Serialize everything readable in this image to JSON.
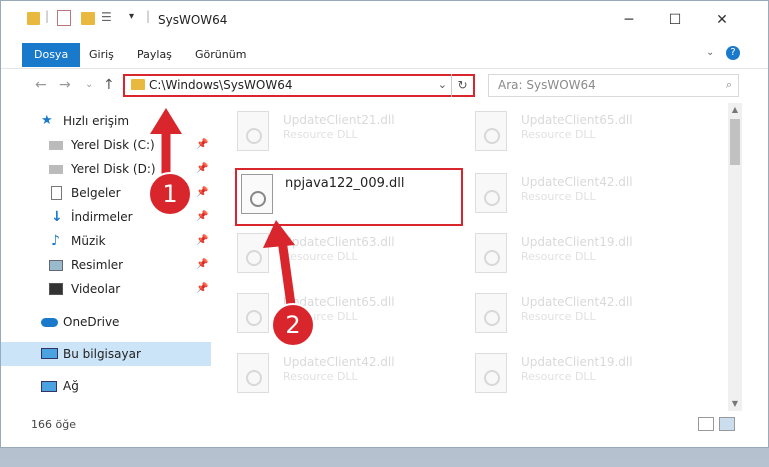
{
  "window": {
    "title": "SysWOW64",
    "controls": {
      "minimize": "─",
      "maximize": "☐",
      "close": "✕"
    }
  },
  "ribbon": {
    "tabs": [
      {
        "label": "Dosya",
        "active": true
      },
      {
        "label": "Giriş"
      },
      {
        "label": "Paylaş"
      },
      {
        "label": "Görünüm"
      }
    ],
    "expand_icon": "chevron-down-icon",
    "help_icon": "?"
  },
  "address": {
    "path": "C:\\Windows\\SysWOW64",
    "search_placeholder": "Ara: SysWOW64"
  },
  "nav": {
    "items": [
      {
        "label": "Hızlı erişim",
        "icon": "star-icon"
      },
      {
        "label": "Yerel Disk (C:)",
        "icon": "drive-icon",
        "pinned": true
      },
      {
        "label": "Yerel Disk (D:)",
        "icon": "drive-icon",
        "pinned": true
      },
      {
        "label": "Belgeler",
        "icon": "documents-icon",
        "pinned": true
      },
      {
        "label": "İndirmeler",
        "icon": "download-icon",
        "pinned": true
      },
      {
        "label": "Müzik",
        "icon": "music-icon",
        "pinned": true
      },
      {
        "label": "Resimler",
        "icon": "pictures-icon",
        "pinned": true
      },
      {
        "label": "Videolar",
        "icon": "videos-icon",
        "pinned": true
      },
      {
        "label": "OneDrive",
        "icon": "cloud-icon"
      },
      {
        "label": "Bu bilgisayar",
        "icon": "computer-icon",
        "selected": true
      },
      {
        "label": "Ağ",
        "icon": "network-icon"
      }
    ]
  },
  "files": {
    "col1": [
      {
        "name": "UpdateClient21.dll",
        "type": "Resource DLL"
      },
      {
        "name": "npjava122_009.dll",
        "type": "",
        "highlight": true
      },
      {
        "name": "UpdateClient63.dll",
        "type": "Resource DLL"
      },
      {
        "name": "UpdateClient65.dll",
        "type": "Resource DLL"
      },
      {
        "name": "UpdateClient42.dll",
        "type": "Resource DLL"
      }
    ],
    "col2": [
      {
        "name": "UpdateClient65.dll",
        "type": "Resource DLL"
      },
      {
        "name": "UpdateClient42.dll",
        "type": "Resource DLL"
      },
      {
        "name": "UpdateClient19.dll",
        "type": "Resource DLL"
      },
      {
        "name": "UpdateClient42.dll",
        "type": "Resource DLL"
      },
      {
        "name": "UpdateClient19.dll",
        "type": "Resource DLL"
      }
    ]
  },
  "status": {
    "count": "166 öğe"
  },
  "annotations": {
    "step1": "1",
    "step2": "2"
  },
  "colors": {
    "accent": "#1979ca",
    "highlight": "#d9262c",
    "selected_bg": "#cce4f7"
  }
}
